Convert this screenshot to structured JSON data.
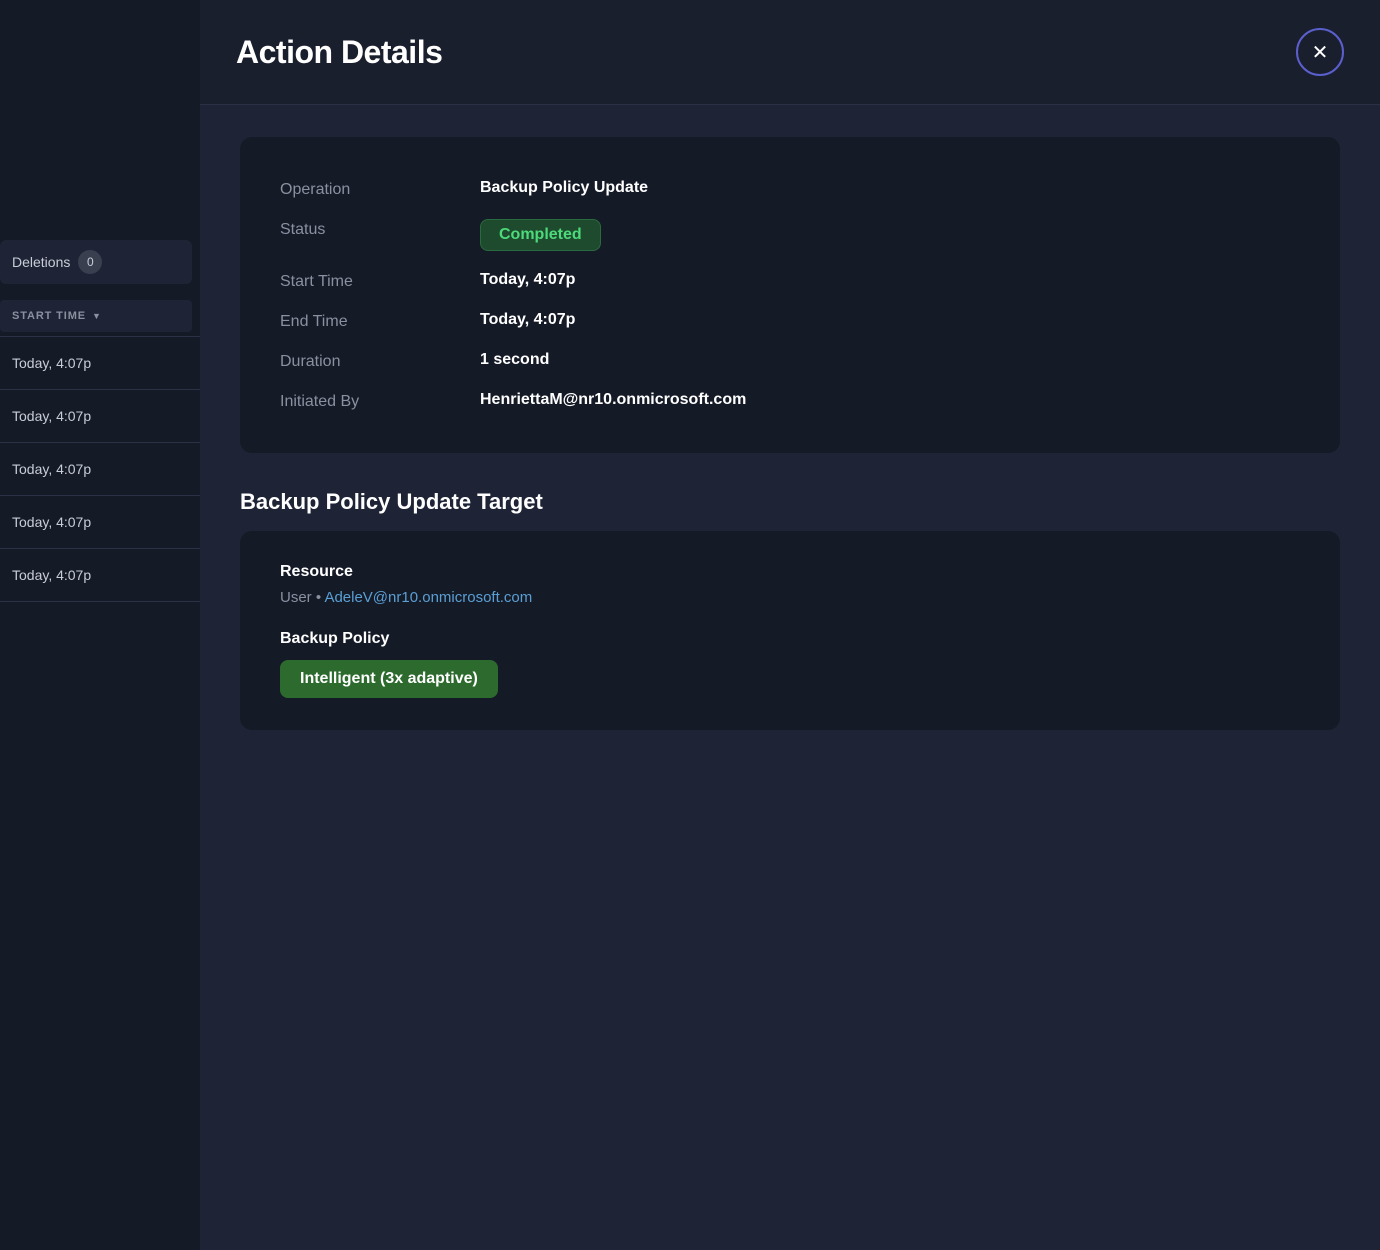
{
  "sidebar": {
    "deletions_label": "Deletions",
    "deletions_count": "0",
    "sort_label": "START TIME",
    "sort_icon": "▼",
    "time_items": [
      "Today, 4:07p",
      "Today, 4:07p",
      "Today, 4:07p",
      "Today, 4:07p",
      "Today, 4:07p"
    ]
  },
  "header": {
    "title": "Action Details",
    "close_label": "✕"
  },
  "details": {
    "operation_label": "Operation",
    "operation_value": "Backup Policy Update",
    "status_label": "Status",
    "status_value": "Completed",
    "start_time_label": "Start Time",
    "start_time_value": "Today, 4:07p",
    "end_time_label": "End Time",
    "end_time_value": "Today, 4:07p",
    "duration_label": "Duration",
    "duration_value": "1 second",
    "initiated_by_label": "Initiated By",
    "initiated_by_value": "HenriettaM@nr10.onmicrosoft.com"
  },
  "target_section": {
    "heading": "Backup Policy Update Target",
    "resource_section_label": "Resource",
    "resource_type": "User",
    "resource_separator": "•",
    "resource_link": "AdeleV@nr10.onmicrosoft.com",
    "policy_section_label": "Backup Policy",
    "policy_value": "Intelligent (3x adaptive)"
  },
  "colors": {
    "status_green": "#4cda7a",
    "link_blue": "#5a9fd4",
    "policy_green": "#2d6a2e"
  }
}
